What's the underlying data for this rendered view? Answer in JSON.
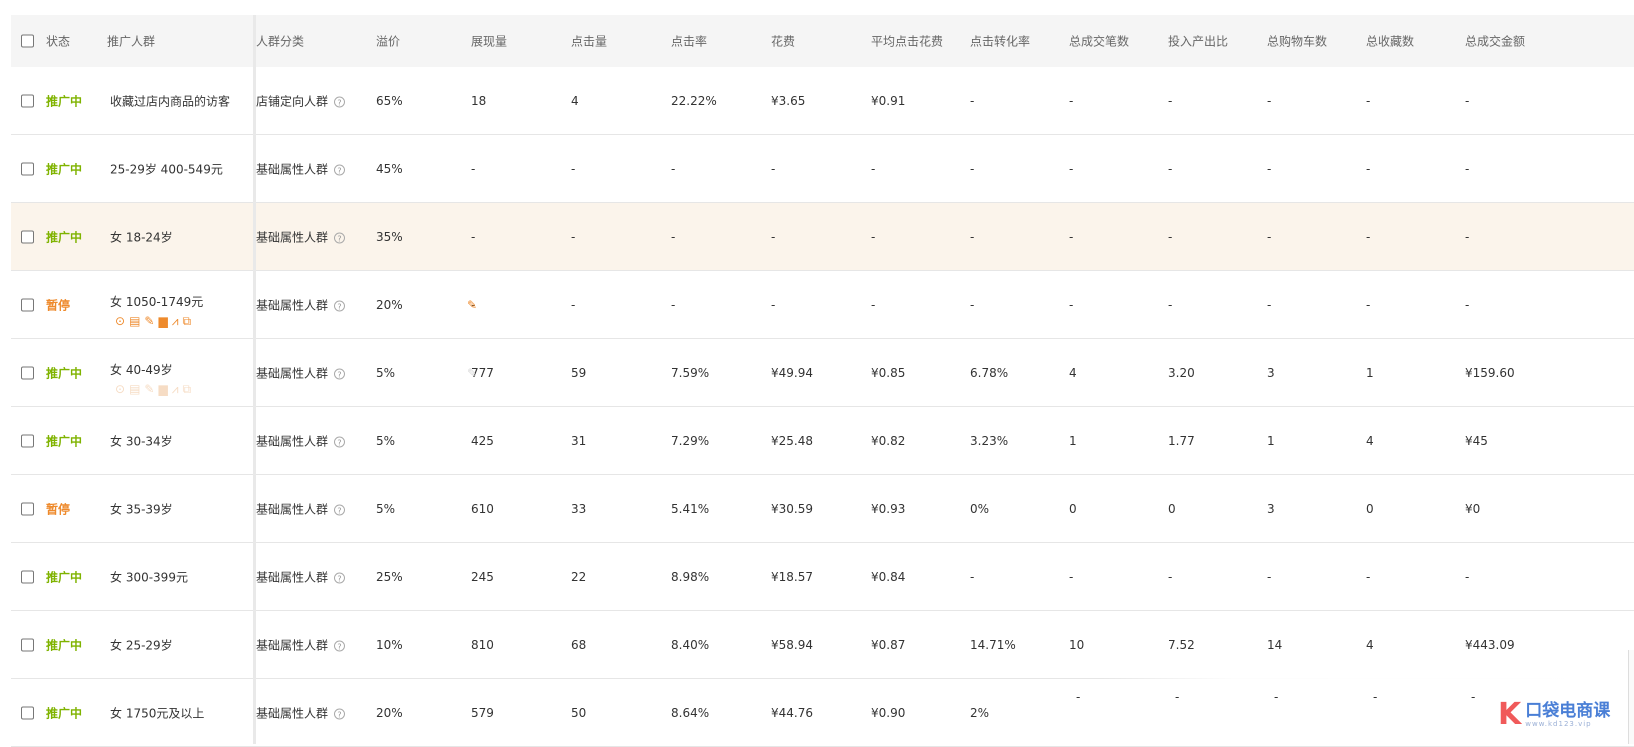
{
  "headers": {
    "status": "状态",
    "audience": "推广人群",
    "category": "人群分类",
    "premium": "溢价",
    "impressions": "展现量",
    "clicks": "点击量",
    "ctr": "点击率",
    "cost": "花费",
    "cpc": "平均点击花费",
    "cvr": "点击转化率",
    "orders": "总成交笔数",
    "roi": "投入产出比",
    "carts": "总购物车数",
    "favs": "总收藏数",
    "gmv": "总成交金额"
  },
  "rows": [
    {
      "status": "推广中",
      "paused": false,
      "audience": "收藏过店内商品的访客",
      "category": "店铺定向人群",
      "premium": "65%",
      "impressions": "18",
      "clicks": "4",
      "ctr": "22.22%",
      "cost": "¥3.65",
      "cpc": "¥0.91",
      "cvr": "-",
      "orders": "-",
      "roi": "-",
      "carts": "-",
      "favs": "-",
      "gmv": "-"
    },
    {
      "status": "推广中",
      "paused": false,
      "audience": "25-29岁 400-549元",
      "category": "基础属性人群",
      "premium": "45%",
      "impressions": "-",
      "clicks": "-",
      "ctr": "-",
      "cost": "-",
      "cpc": "-",
      "cvr": "-",
      "orders": "-",
      "roi": "-",
      "carts": "-",
      "favs": "-",
      "gmv": "-"
    },
    {
      "status": "推广中",
      "paused": false,
      "audience": "女 18-24岁",
      "category": "基础属性人群",
      "premium": "35%",
      "impressions": "-",
      "clicks": "-",
      "ctr": "-",
      "cost": "-",
      "cpc": "-",
      "cvr": "-",
      "orders": "-",
      "roi": "-",
      "carts": "-",
      "favs": "-",
      "gmv": "-"
    },
    {
      "status": "暂停",
      "paused": true,
      "audience": "女 1050-1749元",
      "category": "基础属性人群",
      "premium": "20%",
      "impressions": "-",
      "clicks": "-",
      "ctr": "-",
      "cost": "-",
      "cpc": "-",
      "cvr": "-",
      "orders": "-",
      "roi": "-",
      "carts": "-",
      "favs": "-",
      "gmv": "-"
    },
    {
      "status": "推广中",
      "paused": false,
      "audience": "女 40-49岁",
      "category": "基础属性人群",
      "premium": "5%",
      "impressions": "777",
      "clicks": "59",
      "ctr": "7.59%",
      "cost": "¥49.94",
      "cpc": "¥0.85",
      "cvr": "6.78%",
      "orders": "4",
      "roi": "3.20",
      "carts": "3",
      "favs": "1",
      "gmv": "¥159.60"
    },
    {
      "status": "推广中",
      "paused": false,
      "audience": "女 30-34岁",
      "category": "基础属性人群",
      "premium": "5%",
      "impressions": "425",
      "clicks": "31",
      "ctr": "7.29%",
      "cost": "¥25.48",
      "cpc": "¥0.82",
      "cvr": "3.23%",
      "orders": "1",
      "roi": "1.77",
      "carts": "1",
      "favs": "4",
      "gmv": "¥45"
    },
    {
      "status": "暂停",
      "paused": true,
      "audience": "女 35-39岁",
      "category": "基础属性人群",
      "premium": "5%",
      "impressions": "610",
      "clicks": "33",
      "ctr": "5.41%",
      "cost": "¥30.59",
      "cpc": "¥0.93",
      "cvr": "0%",
      "orders": "0",
      "roi": "0",
      "carts": "3",
      "favs": "0",
      "gmv": "¥0"
    },
    {
      "status": "推广中",
      "paused": false,
      "audience": "女 300-399元",
      "category": "基础属性人群",
      "premium": "25%",
      "impressions": "245",
      "clicks": "22",
      "ctr": "8.98%",
      "cost": "¥18.57",
      "cpc": "¥0.84",
      "cvr": "-",
      "orders": "-",
      "roi": "-",
      "carts": "-",
      "favs": "-",
      "gmv": "-"
    },
    {
      "status": "推广中",
      "paused": false,
      "audience": "女 25-29岁",
      "category": "基础属性人群",
      "premium": "10%",
      "impressions": "810",
      "clicks": "68",
      "ctr": "8.40%",
      "cost": "¥58.94",
      "cpc": "¥0.87",
      "cvr": "14.71%",
      "orders": "10",
      "roi": "7.52",
      "carts": "14",
      "favs": "4",
      "gmv": "¥443.09"
    },
    {
      "status": "推广中",
      "paused": false,
      "audience": "女 1750元及以上",
      "category": "基础属性人群",
      "premium": "20%",
      "impressions": "579",
      "clicks": "50",
      "ctr": "8.64%",
      "cost": "¥44.76",
      "cpc": "¥0.90",
      "cvr": "2%",
      "orders": "",
      "roi": "",
      "carts": "",
      "favs": "",
      "gmv": ""
    }
  ],
  "overlay_dashes": [
    "-",
    "-",
    "-",
    "-",
    "-"
  ],
  "row_icons": [
    "play-circle-icon",
    "report-icon",
    "edit-icon",
    "delete-icon",
    "trend-chart-icon",
    "copy-icon"
  ],
  "help_glyph": "?",
  "watermark": {
    "brand": "口袋电商课",
    "url": "www.kd123.vip"
  },
  "colors": {
    "active": "#7fb300",
    "paused": "#ee8a2c",
    "highlight_row": "#fbf4eb",
    "header_bg": "#f5f5f5",
    "watermark_blue": "#4a7fd6",
    "watermark_red": "#f05a5a"
  }
}
